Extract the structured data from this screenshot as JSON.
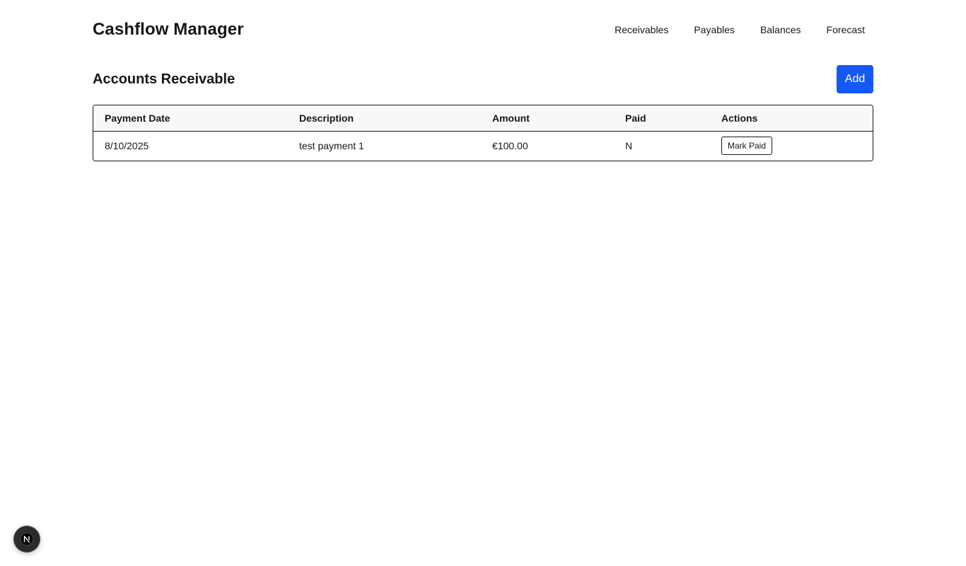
{
  "app": {
    "title": "Cashflow Manager"
  },
  "nav": {
    "items": [
      {
        "label": "Receivables"
      },
      {
        "label": "Payables"
      },
      {
        "label": "Balances"
      },
      {
        "label": "Forecast"
      }
    ]
  },
  "section": {
    "title": "Accounts Receivable",
    "add_label": "Add"
  },
  "table": {
    "columns": [
      "Payment Date",
      "Description",
      "Amount",
      "Paid",
      "Actions"
    ],
    "rows": [
      {
        "payment_date": "8/10/2025",
        "description": "test payment 1",
        "amount": "€100.00",
        "paid": "N",
        "action_label": "Mark Paid"
      }
    ]
  },
  "dev_badge": {
    "icon": "nextjs-logo-icon"
  },
  "colors": {
    "accent": "#1458f5",
    "header_bg": "#f7f8fa",
    "text": "#171717",
    "badge_bg": "#2b2b2b"
  }
}
